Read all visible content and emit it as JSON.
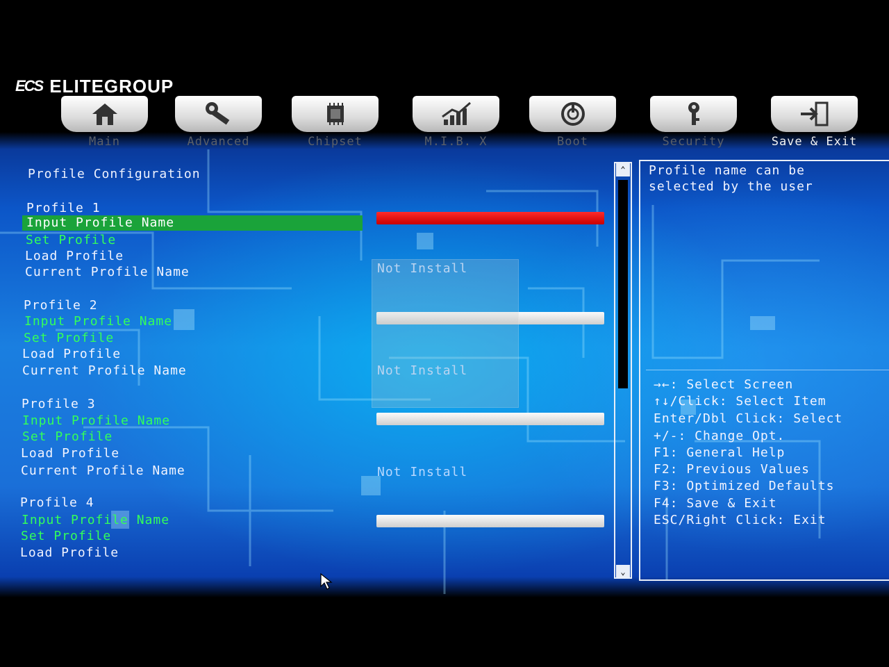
{
  "brand": {
    "mark": "ECS",
    "name": "ELITEGROUP"
  },
  "tabs": [
    {
      "label": "Main",
      "icon": "home-icon"
    },
    {
      "label": "Advanced",
      "icon": "wrench-icon"
    },
    {
      "label": "Chipset",
      "icon": "chip-icon"
    },
    {
      "label": "M.I.B. X",
      "icon": "performance-chart-icon"
    },
    {
      "label": "Boot",
      "icon": "power-icon"
    },
    {
      "label": "Security",
      "icon": "key-icon"
    },
    {
      "label": "Save & Exit",
      "icon": "exit-door-icon",
      "active": true
    }
  ],
  "page_title": "Profile Configuration",
  "profiles": [
    {
      "header": "Profile 1",
      "input": "Input Profile Name",
      "set": "Set Profile",
      "load": "Load Profile",
      "current": "Current Profile Name",
      "value": "Not Install"
    },
    {
      "header": "Profile 2",
      "input": "Input Profile Name",
      "set": "Set Profile",
      "load": "Load Profile",
      "current": "Current Profile Name",
      "value": "Not Install"
    },
    {
      "header": "Profile 3",
      "input": "Input Profile Name",
      "set": "Set Profile",
      "load": "Load Profile",
      "current": "Current Profile Name",
      "value": "Not Install"
    },
    {
      "header": "Profile 4",
      "input": "Input Profile Name",
      "set": "Set Profile",
      "load": "Load Profile"
    }
  ],
  "help": {
    "description": "Profile name can be\nselected by the user",
    "keys": [
      "→←: Select Screen",
      "↑↓/Click: Select Item",
      "Enter/Dbl Click: Select",
      "+/-: Change Opt.",
      "F1: General Help",
      "F2: Previous Values",
      "F3: Optimized Defaults",
      "F4: Save & Exit",
      "ESC/Right Click: Exit"
    ]
  },
  "scrollbar": {
    "up_glyph": "⌃",
    "down_glyph": "⌄"
  },
  "colors": {
    "selected": "#1aa33a",
    "active_field": "#e01010",
    "option_green": "#33ff5a"
  }
}
